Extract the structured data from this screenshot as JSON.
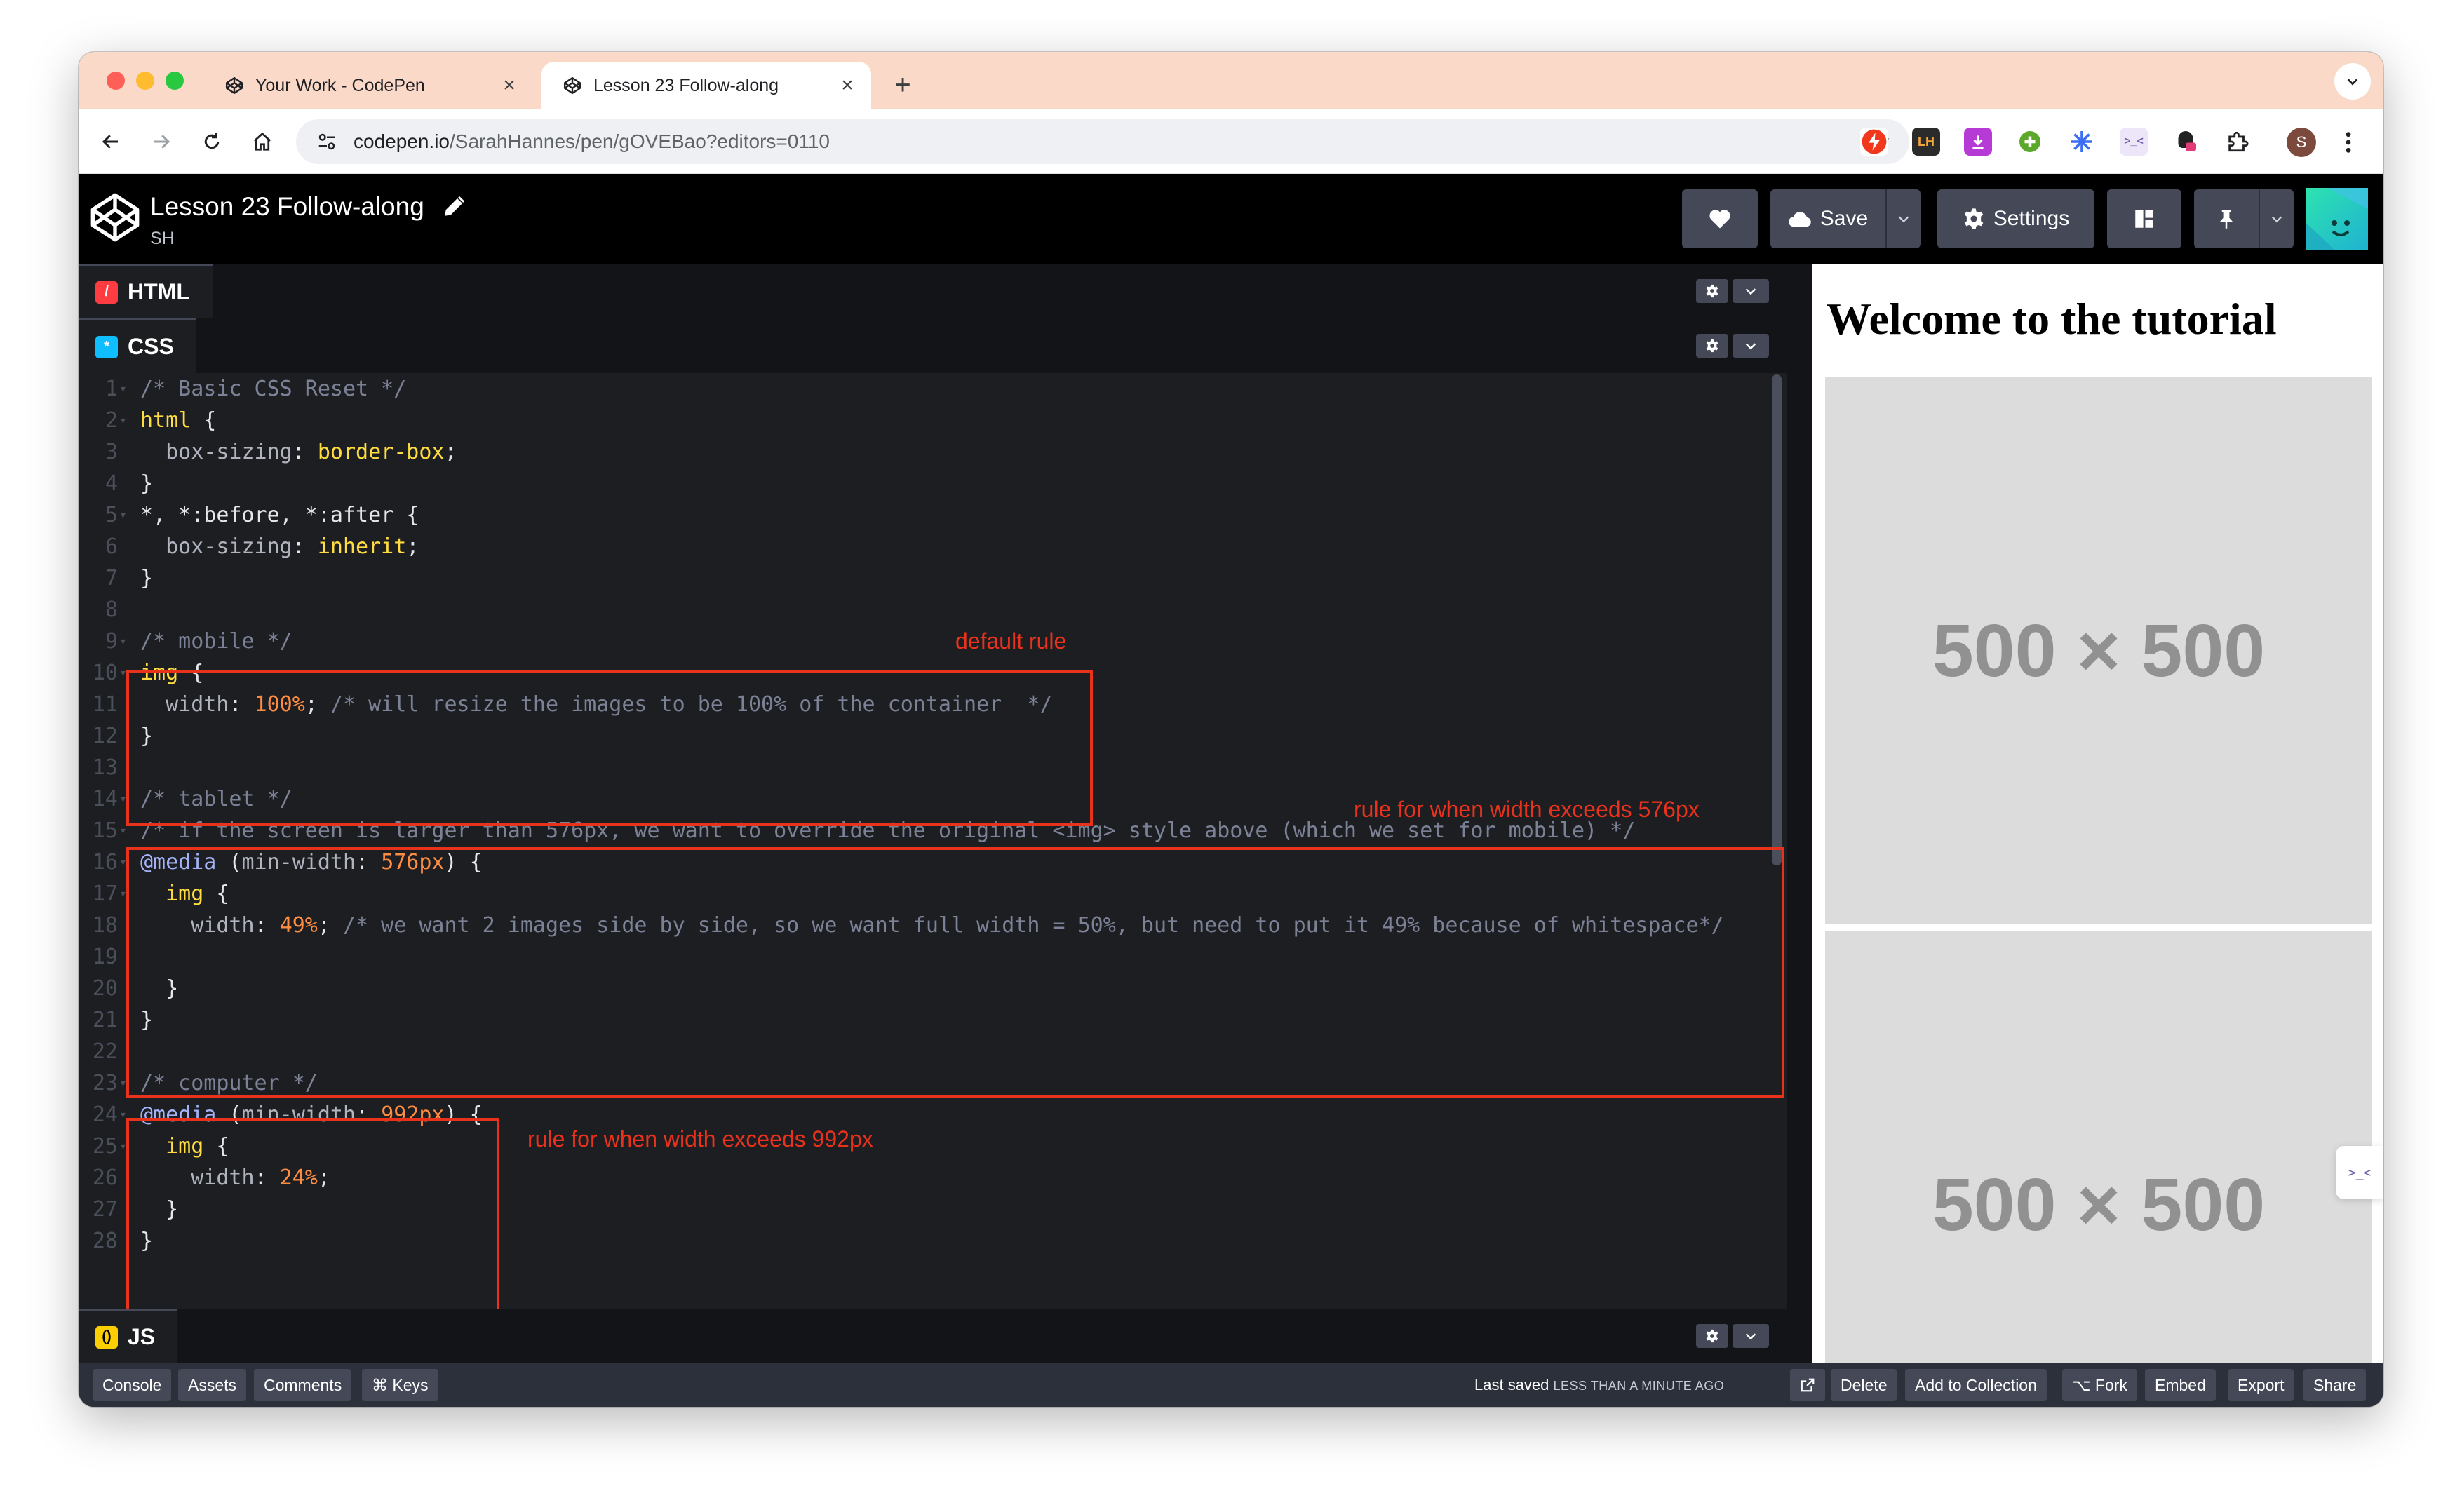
{
  "browser": {
    "tabs": [
      {
        "title": "Your Work - CodePen",
        "active": false
      },
      {
        "title": "Lesson 23 Follow-along",
        "active": true
      }
    ],
    "new_tab": "+",
    "url_host": "codepen.io",
    "url_path": "/SarahHannes/pen/gOVEBao?editors=0110",
    "profile_initial": "S",
    "extensions": [
      "lightning-extension-icon",
      "lighthouse-extension-icon",
      "download-extension-icon",
      "plus-extension-icon",
      "asterisk-extension-icon",
      "pixel-extension-icon",
      "css-extension-icon",
      "puzzle-extensions-icon"
    ]
  },
  "codepen": {
    "title": "Lesson 23 Follow-along",
    "user": "SH",
    "save_label": "Save",
    "settings_label": "Settings"
  },
  "editors": {
    "html_label": "HTML",
    "css_label": "CSS",
    "js_label": "JS"
  },
  "css_code": [
    {
      "n": "1",
      "fold": true,
      "parts": [
        [
          "c-com",
          "/* Basic CSS Reset */"
        ]
      ]
    },
    {
      "n": "2",
      "fold": true,
      "parts": [
        [
          "c-sel",
          "html"
        ],
        [
          "c-pun",
          " {"
        ]
      ]
    },
    {
      "n": "3",
      "fold": false,
      "parts": [
        [
          "c-prop",
          "  box-sizing"
        ],
        [
          "c-pun",
          ": "
        ],
        [
          "c-val",
          "border-box"
        ],
        [
          "c-pun",
          ";"
        ]
      ]
    },
    {
      "n": "4",
      "fold": false,
      "parts": [
        [
          "c-pun",
          "}"
        ]
      ]
    },
    {
      "n": "5",
      "fold": true,
      "parts": [
        [
          "c-pun",
          "*, *:before, *:after {"
        ]
      ]
    },
    {
      "n": "6",
      "fold": false,
      "parts": [
        [
          "c-prop",
          "  box-sizing"
        ],
        [
          "c-pun",
          ": "
        ],
        [
          "c-val",
          "inherit"
        ],
        [
          "c-pun",
          ";"
        ]
      ]
    },
    {
      "n": "7",
      "fold": false,
      "parts": [
        [
          "c-pun",
          "}"
        ]
      ]
    },
    {
      "n": "8",
      "fold": false,
      "parts": []
    },
    {
      "n": "9",
      "fold": true,
      "parts": [
        [
          "c-com",
          "/* mobile */"
        ]
      ]
    },
    {
      "n": "10",
      "fold": true,
      "parts": [
        [
          "c-sel",
          "img"
        ],
        [
          "c-pun",
          " {"
        ]
      ]
    },
    {
      "n": "11",
      "fold": false,
      "parts": [
        [
          "c-prop",
          "  width"
        ],
        [
          "c-pun",
          ": "
        ],
        [
          "c-num",
          "100%"
        ],
        [
          "c-pun",
          "; "
        ],
        [
          "c-com",
          "/* will resize the images to be 100% of the container  */"
        ]
      ]
    },
    {
      "n": "12",
      "fold": false,
      "parts": [
        [
          "c-pun",
          "}"
        ]
      ]
    },
    {
      "n": "13",
      "fold": false,
      "parts": []
    },
    {
      "n": "14",
      "fold": true,
      "parts": [
        [
          "c-com",
          "/* tablet */"
        ]
      ]
    },
    {
      "n": "15",
      "fold": true,
      "parts": [
        [
          "c-com",
          "/* if the screen is larger than 576px, we want to override the original <img> style above (which we set for mobile) */"
        ]
      ]
    },
    {
      "n": "16",
      "fold": true,
      "parts": [
        [
          "c-at",
          "@media"
        ],
        [
          "c-pun",
          " ("
        ],
        [
          "c-prop",
          "min-width"
        ],
        [
          "c-pun",
          ": "
        ],
        [
          "c-num",
          "576px"
        ],
        [
          "c-pun",
          ") {"
        ]
      ]
    },
    {
      "n": "17",
      "fold": true,
      "parts": [
        [
          "c-sel",
          "  img"
        ],
        [
          "c-pun",
          " {"
        ]
      ]
    },
    {
      "n": "18",
      "fold": false,
      "parts": [
        [
          "c-prop",
          "    width"
        ],
        [
          "c-pun",
          ": "
        ],
        [
          "c-num",
          "49%"
        ],
        [
          "c-pun",
          "; "
        ],
        [
          "c-com",
          "/* we want 2 images side by side, so we want full width = 50%, but need to put it 49% because of whitespace*/"
        ]
      ]
    },
    {
      "n": "19",
      "fold": false,
      "parts": []
    },
    {
      "n": "20",
      "fold": false,
      "parts": [
        [
          "c-pun",
          "  }"
        ]
      ]
    },
    {
      "n": "21",
      "fold": false,
      "parts": [
        [
          "c-pun",
          "}"
        ]
      ]
    },
    {
      "n": "22",
      "fold": false,
      "parts": []
    },
    {
      "n": "23",
      "fold": true,
      "parts": [
        [
          "c-com",
          "/* computer */"
        ]
      ]
    },
    {
      "n": "24",
      "fold": true,
      "parts": [
        [
          "c-at",
          "@media"
        ],
        [
          "c-pun",
          " ("
        ],
        [
          "c-prop",
          "min-width"
        ],
        [
          "c-pun",
          ": "
        ],
        [
          "c-num",
          "992px"
        ],
        [
          "c-pun",
          ") {"
        ]
      ]
    },
    {
      "n": "25",
      "fold": true,
      "parts": [
        [
          "c-sel",
          "  img"
        ],
        [
          "c-pun",
          " {"
        ]
      ]
    },
    {
      "n": "26",
      "fold": false,
      "parts": [
        [
          "c-prop",
          "    width"
        ],
        [
          "c-pun",
          ": "
        ],
        [
          "c-num",
          "24%"
        ],
        [
          "c-pun",
          ";"
        ]
      ]
    },
    {
      "n": "27",
      "fold": false,
      "parts": [
        [
          "c-pun",
          "  }"
        ]
      ]
    },
    {
      "n": "28",
      "fold": false,
      "parts": [
        [
          "c-pun",
          "}"
        ]
      ]
    }
  ],
  "annotations": {
    "default_rule": "default rule",
    "rule_576": "rule for when width exceeds 576px",
    "rule_992": "rule for when width exceeds 992px"
  },
  "preview": {
    "heading": "Welcome to the tutorial",
    "placeholder_1": "500 × 500",
    "placeholder_2": "500 × 500"
  },
  "footer": {
    "console": "Console",
    "assets": "Assets",
    "comments": "Comments",
    "keys": "⌘ Keys",
    "last_saved_prefix": "Last saved ",
    "last_saved_time": "LESS THAN A MINUTE AGO",
    "delete": "Delete",
    "add_to_collection": "Add to Collection",
    "fork": "⌥ Fork",
    "embed": "Embed",
    "export": "Export",
    "share": "Share"
  },
  "colors": {
    "tab_strip": "#fbd9c9",
    "annotation": "#e8321c",
    "editor_bg": "#1d1e22",
    "button_bg": "#444857"
  }
}
